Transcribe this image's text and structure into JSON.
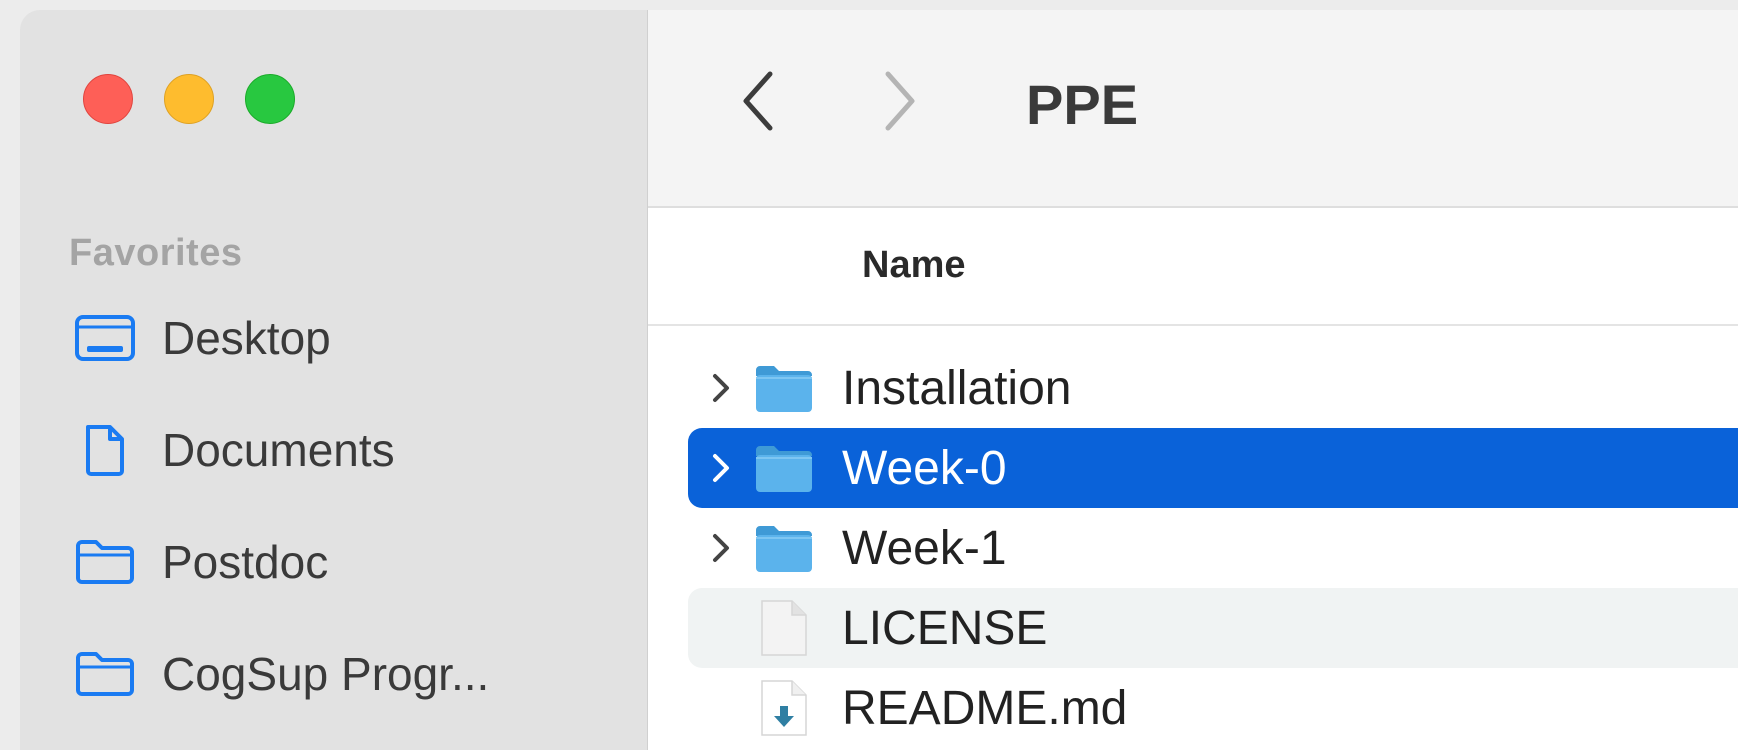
{
  "window": {
    "buttons": {
      "close": "close",
      "minimize": "minimize",
      "zoom": "zoom"
    }
  },
  "sidebar": {
    "section_title": "Favorites",
    "items": [
      {
        "label": "Desktop",
        "icon": "desktop-icon"
      },
      {
        "label": "Documents",
        "icon": "document-icon"
      },
      {
        "label": "Postdoc",
        "icon": "folder-icon"
      },
      {
        "label": "CogSup Progr...",
        "icon": "folder-icon"
      }
    ]
  },
  "toolbar": {
    "back_icon": "chevron-left-icon",
    "forward_icon": "chevron-right-icon",
    "title": "PPE"
  },
  "list": {
    "column_name": "Name",
    "rows": [
      {
        "name": "Installation",
        "type": "folder",
        "expandable": true,
        "selected": false
      },
      {
        "name": "Week-0",
        "type": "folder",
        "expandable": true,
        "selected": true
      },
      {
        "name": "Week-1",
        "type": "folder",
        "expandable": true,
        "selected": false
      },
      {
        "name": "LICENSE",
        "type": "file",
        "expandable": false,
        "selected": false
      },
      {
        "name": "README.md",
        "type": "markdown",
        "expandable": false,
        "selected": false
      }
    ]
  },
  "colors": {
    "accent": "#0a62d9",
    "sidebar_icon": "#1a7bf2",
    "folder": "#5bb3ec"
  }
}
